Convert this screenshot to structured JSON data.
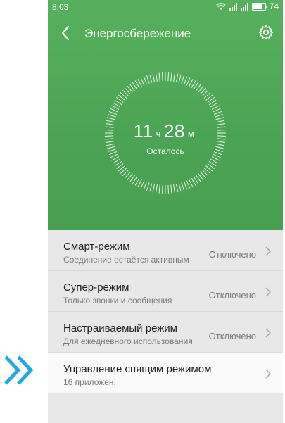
{
  "status_bar": {
    "time": "8:03",
    "battery": "74"
  },
  "header": {
    "title": "Энергосбережение"
  },
  "gauge": {
    "hours": "11",
    "hours_unit": "ч",
    "minutes": "28",
    "minutes_unit": "м",
    "caption": "Осталось"
  },
  "modes": [
    {
      "title": "Смарт-режим",
      "subtitle": "Соединение остаётся активным",
      "status": "Отключено"
    },
    {
      "title": "Супер-режим",
      "subtitle": "Только звонки и сообщения",
      "status": "Отключено"
    },
    {
      "title": "Настраиваемый режим",
      "subtitle": "Для ежедневного использования",
      "status": "Отключено"
    },
    {
      "title": "Управление спящим режимом",
      "subtitle": "16 приложен.",
      "status": ""
    }
  ],
  "colors": {
    "hero_green": "#4fa957",
    "arrow_blue": "#1fa9e6"
  }
}
